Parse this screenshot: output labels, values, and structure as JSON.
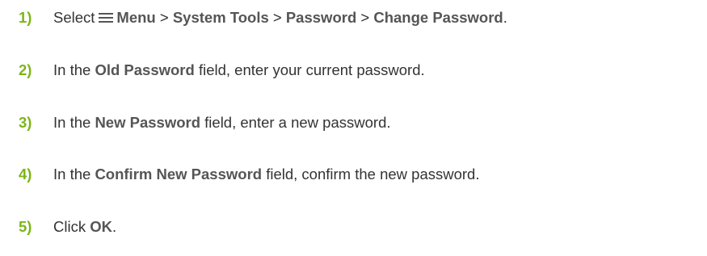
{
  "steps": [
    {
      "number": "1)",
      "prefix": "Select",
      "menu": "Menu",
      "sep1": ">",
      "system_tools": "System Tools",
      "sep2": ">",
      "password": "Password",
      "sep3": ">",
      "change_password": "Change Password",
      "suffix": "."
    },
    {
      "number": "2)",
      "prefix": "In the ",
      "field": "Old Password",
      "suffix": " field, enter your current password."
    },
    {
      "number": "3)",
      "prefix": "In the ",
      "field": "New Password",
      "suffix": " field, enter a new password."
    },
    {
      "number": "4)",
      "prefix": "In the ",
      "field": "Confirm New Password",
      "suffix": " field, confirm the new password."
    },
    {
      "number": "5)",
      "prefix": "Click ",
      "button": "OK",
      "suffix": "."
    }
  ],
  "colors": {
    "step_number": "#7cb518",
    "body_text": "#333333",
    "ui_term": "#555555"
  },
  "icons": {
    "menu": "hamburger-menu-icon"
  }
}
